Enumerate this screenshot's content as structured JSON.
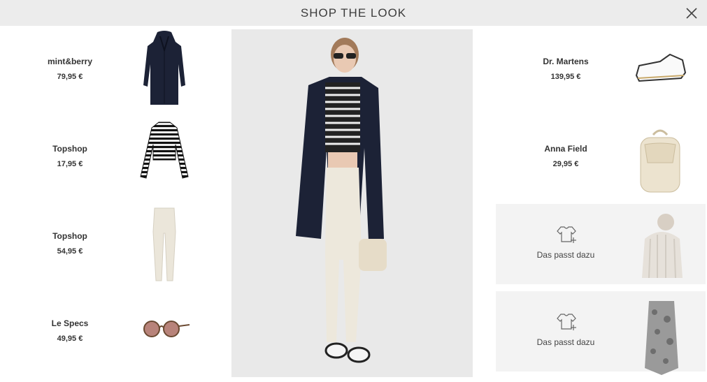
{
  "header": {
    "title": "SHOP THE LOOK"
  },
  "left_products": [
    {
      "brand": "mint&berry",
      "price": "79,95 €"
    },
    {
      "brand": "Topshop",
      "price": "17,95 €"
    },
    {
      "brand": "Topshop",
      "price": "54,95 €"
    },
    {
      "brand": "Le Specs",
      "price": "49,95 €"
    }
  ],
  "right_products": [
    {
      "brand": "Dr. Martens",
      "price": "139,95 €"
    },
    {
      "brand": "Anna Field",
      "price": "29,95 €"
    }
  ],
  "suggestions": [
    {
      "label": "Das passt dazu",
      "icon": "tshirt-plus-icon"
    },
    {
      "label": "Das passt dazu",
      "icon": "tshirt-plus-icon"
    }
  ],
  "colors": {
    "header_bg": "#ececec",
    "suggest_bg": "#f3f3f3",
    "text": "#333333"
  }
}
